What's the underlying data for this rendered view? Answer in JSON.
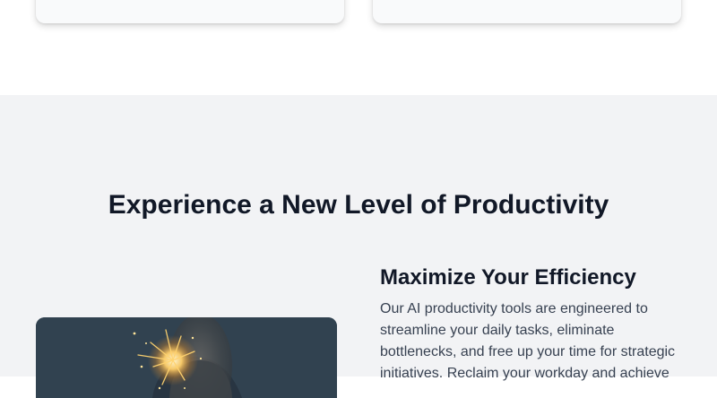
{
  "section": {
    "title": "Experience a New Level of Productivity"
  },
  "feature": {
    "heading": "Maximize Your Efficiency",
    "body": "Our AI productivity tools are engineered to streamline your daily tasks, eliminate bottlenecks, and free up your time for strategic initiatives. Reclaim your workday and achieve"
  },
  "colors": {
    "section_background": "#f2f3f5",
    "title_text": "#111827",
    "body_text": "#374151"
  },
  "image": {
    "subject": "sparkler-photo"
  }
}
